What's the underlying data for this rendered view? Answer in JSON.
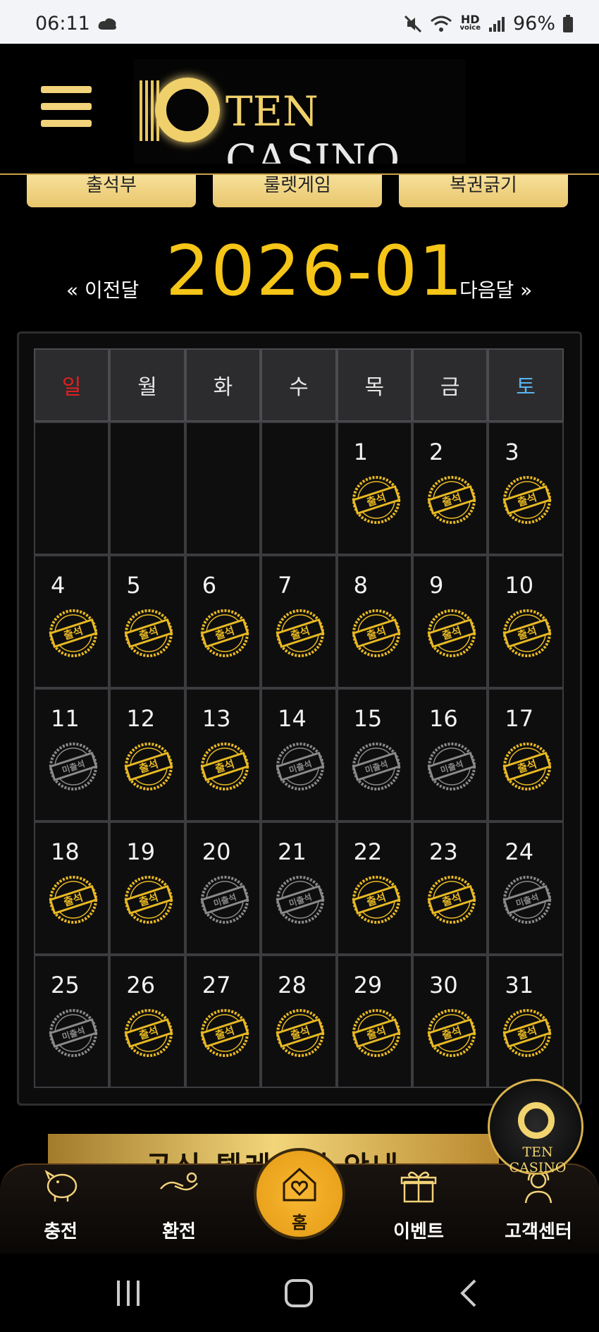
{
  "status_bar": {
    "time": "06:11",
    "hd_label": "HD",
    "voice_label": "voice",
    "battery": "96%"
  },
  "header": {
    "logo_ten": "TEN",
    "logo_casino": "CASINO"
  },
  "quick_buttons": [
    "출석부",
    "룰렛게임",
    "복권긁기"
  ],
  "calendar": {
    "prev_label": "« 이전달",
    "next_label": "다음달 »",
    "month": "2026-01",
    "weekdays": [
      "일",
      "월",
      "화",
      "수",
      "목",
      "금",
      "토"
    ],
    "weekday_colors": {
      "sunday": "#e02020",
      "saturday": "#5ab4f0",
      "default": "#e6e6e6"
    },
    "stamp_attended": "출석",
    "stamp_absent": "미출석",
    "weeks": [
      [
        null,
        null,
        null,
        null,
        {
          "day": "1",
          "attended": true
        },
        {
          "day": "2",
          "attended": true
        },
        {
          "day": "3",
          "attended": true
        }
      ],
      [
        {
          "day": "4",
          "attended": true
        },
        {
          "day": "5",
          "attended": true
        },
        {
          "day": "6",
          "attended": true
        },
        {
          "day": "7",
          "attended": true
        },
        {
          "day": "8",
          "attended": true
        },
        {
          "day": "9",
          "attended": true
        },
        {
          "day": "10",
          "attended": true
        }
      ],
      [
        {
          "day": "11",
          "attended": false
        },
        {
          "day": "12",
          "attended": true
        },
        {
          "day": "13",
          "attended": true
        },
        {
          "day": "14",
          "attended": false
        },
        {
          "day": "15",
          "attended": false
        },
        {
          "day": "16",
          "attended": false
        },
        {
          "day": "17",
          "attended": true
        }
      ],
      [
        {
          "day": "18",
          "attended": true
        },
        {
          "day": "19",
          "attended": true
        },
        {
          "day": "20",
          "attended": false
        },
        {
          "day": "21",
          "attended": false
        },
        {
          "day": "22",
          "attended": true
        },
        {
          "day": "23",
          "attended": true
        },
        {
          "day": "24",
          "attended": false
        }
      ],
      [
        {
          "day": "25",
          "attended": false
        },
        {
          "day": "26",
          "attended": true
        },
        {
          "day": "27",
          "attended": true
        },
        {
          "day": "28",
          "attended": true
        },
        {
          "day": "29",
          "attended": true
        },
        {
          "day": "30",
          "attended": true
        },
        {
          "day": "31",
          "attended": true
        }
      ]
    ]
  },
  "banner": {
    "text": "공식 텔레그램 안내"
  },
  "floating_logo": {
    "text": "TEN CASINO"
  },
  "bottom_nav": {
    "deposit": "충전",
    "withdraw": "환전",
    "home": "홈",
    "event": "이벤트",
    "support": "고객센터"
  },
  "colors": {
    "accent_gold": "#f5c518",
    "attended_stamp": "#e8b923",
    "absent_stamp": "#8a8a8a"
  }
}
